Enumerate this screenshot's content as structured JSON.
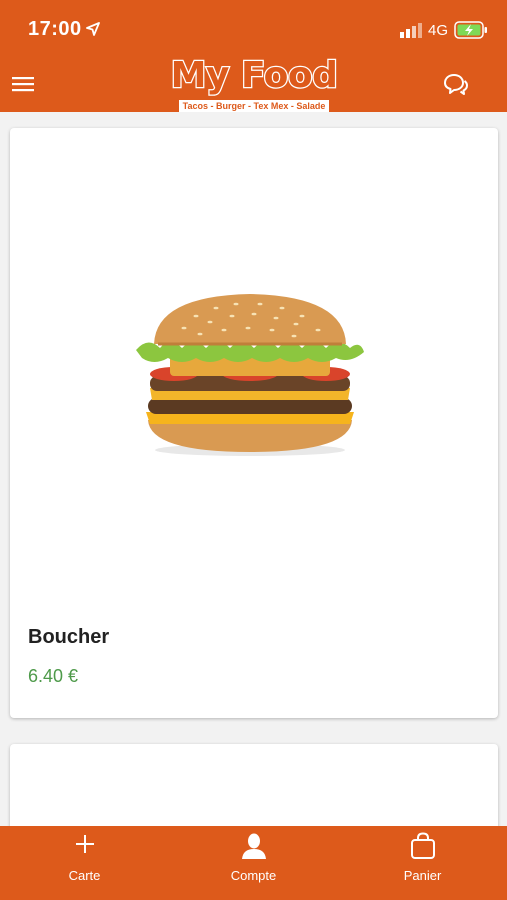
{
  "status_bar": {
    "time": "17:00",
    "network": "4G",
    "icons": [
      "location-arrow-icon",
      "signal-icon",
      "battery-charging-icon"
    ]
  },
  "header": {
    "logo_title": "My Food",
    "logo_subtitle": "Tacos - Burger - Tex Mex - Salade",
    "icons": [
      "menu-icon",
      "chat-icon"
    ]
  },
  "products": [
    {
      "name": "Boucher",
      "price": "6.40 €",
      "image": "burger-image"
    }
  ],
  "tabs": [
    {
      "label": "Carte",
      "icon": "plus-icon"
    },
    {
      "label": "Compte",
      "icon": "user-icon"
    },
    {
      "label": "Panier",
      "icon": "bag-icon"
    }
  ],
  "colors": {
    "brand": "#dd5a1b",
    "price": "#4e9a4a",
    "background": "#f2f2f2"
  }
}
